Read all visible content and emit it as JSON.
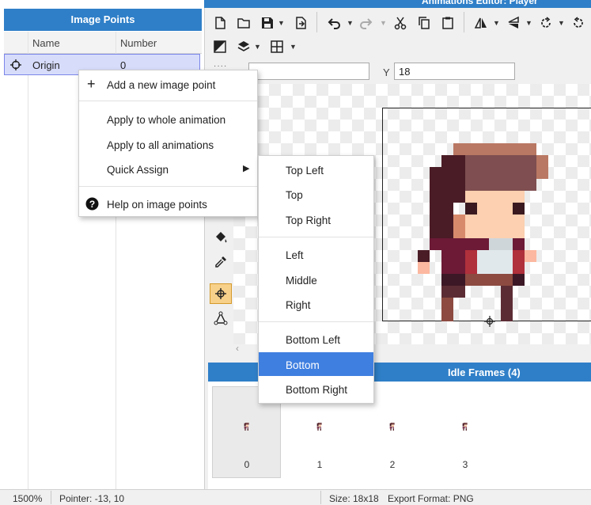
{
  "window": {
    "title": "Animations Editor: Player"
  },
  "image_points_panel": {
    "title": "Image Points",
    "columns": [
      "Name",
      "Number"
    ],
    "rows": [
      {
        "name": "Origin",
        "number": "0",
        "icon": "crosshair-icon"
      }
    ]
  },
  "toolbar": {
    "row1": [
      "new-file-icon",
      "open-folder-icon",
      "save-icon",
      "save-as-icon",
      "undo-icon",
      "redo-icon",
      "cut-icon",
      "copy-icon",
      "paste-icon",
      "flip-horizontal-icon",
      "flip-vertical-icon",
      "rotate-left-icon",
      "rotate-right-icon"
    ],
    "row2": [
      "color-mode-icon",
      "layers-icon",
      "grid-icon"
    ]
  },
  "coordinates": {
    "x_value": "",
    "y_label": "Y",
    "y_value": "18"
  },
  "tools": [
    "fill-icon",
    "eyedropper-icon",
    "image-point-tool-icon",
    "polygon-tool-icon"
  ],
  "context_menu": {
    "add": "Add a new image point",
    "apply_whole": "Apply to whole animation",
    "apply_all": "Apply to all animations",
    "quick_assign": "Quick Assign",
    "help": "Help on image points"
  },
  "quick_assign_menu": {
    "items": [
      "Top Left",
      "Top",
      "Top Right",
      "Left",
      "Middle",
      "Right",
      "Bottom Left",
      "Bottom",
      "Bottom Right"
    ],
    "highlighted": "Bottom"
  },
  "frames_panel": {
    "title": "Idle Frames (4)",
    "frames": [
      "0",
      "1",
      "2",
      "3"
    ],
    "selected": "0"
  },
  "status_bar": {
    "zoom": "1500%",
    "pointer": "Pointer: -13, 10",
    "size": "Size: 18x18",
    "export_format": "Export Format: PNG"
  },
  "colors": {
    "accent": "#2f7fc8",
    "highlight": "#3f7fe0",
    "selected_row": "#d7dcfb",
    "tool_active": "#f7d08a",
    "hair": "#4a1c26",
    "hat": "#b97863",
    "skin": "#fcd0b0",
    "shirt": "#6c1a36",
    "shirt_red": "#b0303c",
    "apron": "#e1e8ec",
    "legs": "#5c2c34"
  }
}
